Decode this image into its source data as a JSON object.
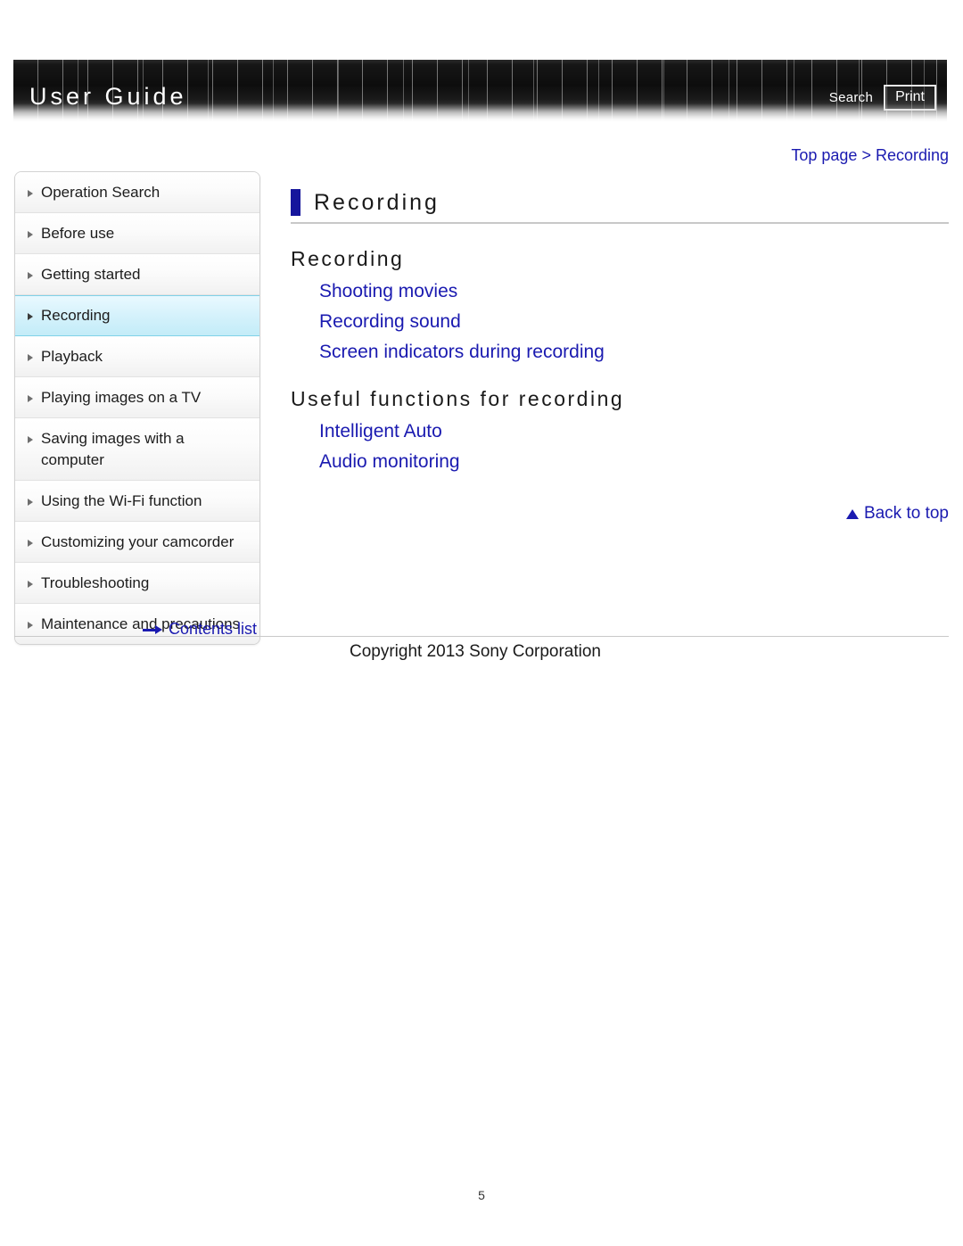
{
  "header": {
    "title": "User Guide",
    "search_label": "Search",
    "print_label": "Print"
  },
  "breadcrumb": {
    "text": "Top page > Recording"
  },
  "sidebar": {
    "items": [
      {
        "label": "Operation Search",
        "active": false
      },
      {
        "label": "Before use",
        "active": false
      },
      {
        "label": "Getting started",
        "active": false
      },
      {
        "label": "Recording",
        "active": true
      },
      {
        "label": "Playback",
        "active": false
      },
      {
        "label": "Playing images on a TV",
        "active": false
      },
      {
        "label": "Saving images with a computer",
        "active": false
      },
      {
        "label": "Using the Wi-Fi function",
        "active": false
      },
      {
        "label": "Customizing your camcorder",
        "active": false
      },
      {
        "label": "Troubleshooting",
        "active": false
      },
      {
        "label": "Maintenance and precautions",
        "active": false
      }
    ],
    "contents_list_label": "Contents list"
  },
  "main": {
    "page_title": "Recording",
    "sections": [
      {
        "heading": "Recording",
        "links": [
          "Shooting movies",
          "Recording sound",
          "Screen indicators during recording"
        ]
      },
      {
        "heading": "Useful functions for recording",
        "links": [
          "Intelligent Auto",
          "Audio monitoring"
        ]
      }
    ],
    "back_to_top_label": "Back to top"
  },
  "footer": {
    "copyright": "Copyright 2013 Sony Corporation",
    "page_number": "5"
  },
  "colors": {
    "link_blue": "#1a1ab0",
    "title_bar_blue": "#16169c",
    "active_item_cyan": "#c3ecf8",
    "header_black": "#0d0d0d"
  }
}
